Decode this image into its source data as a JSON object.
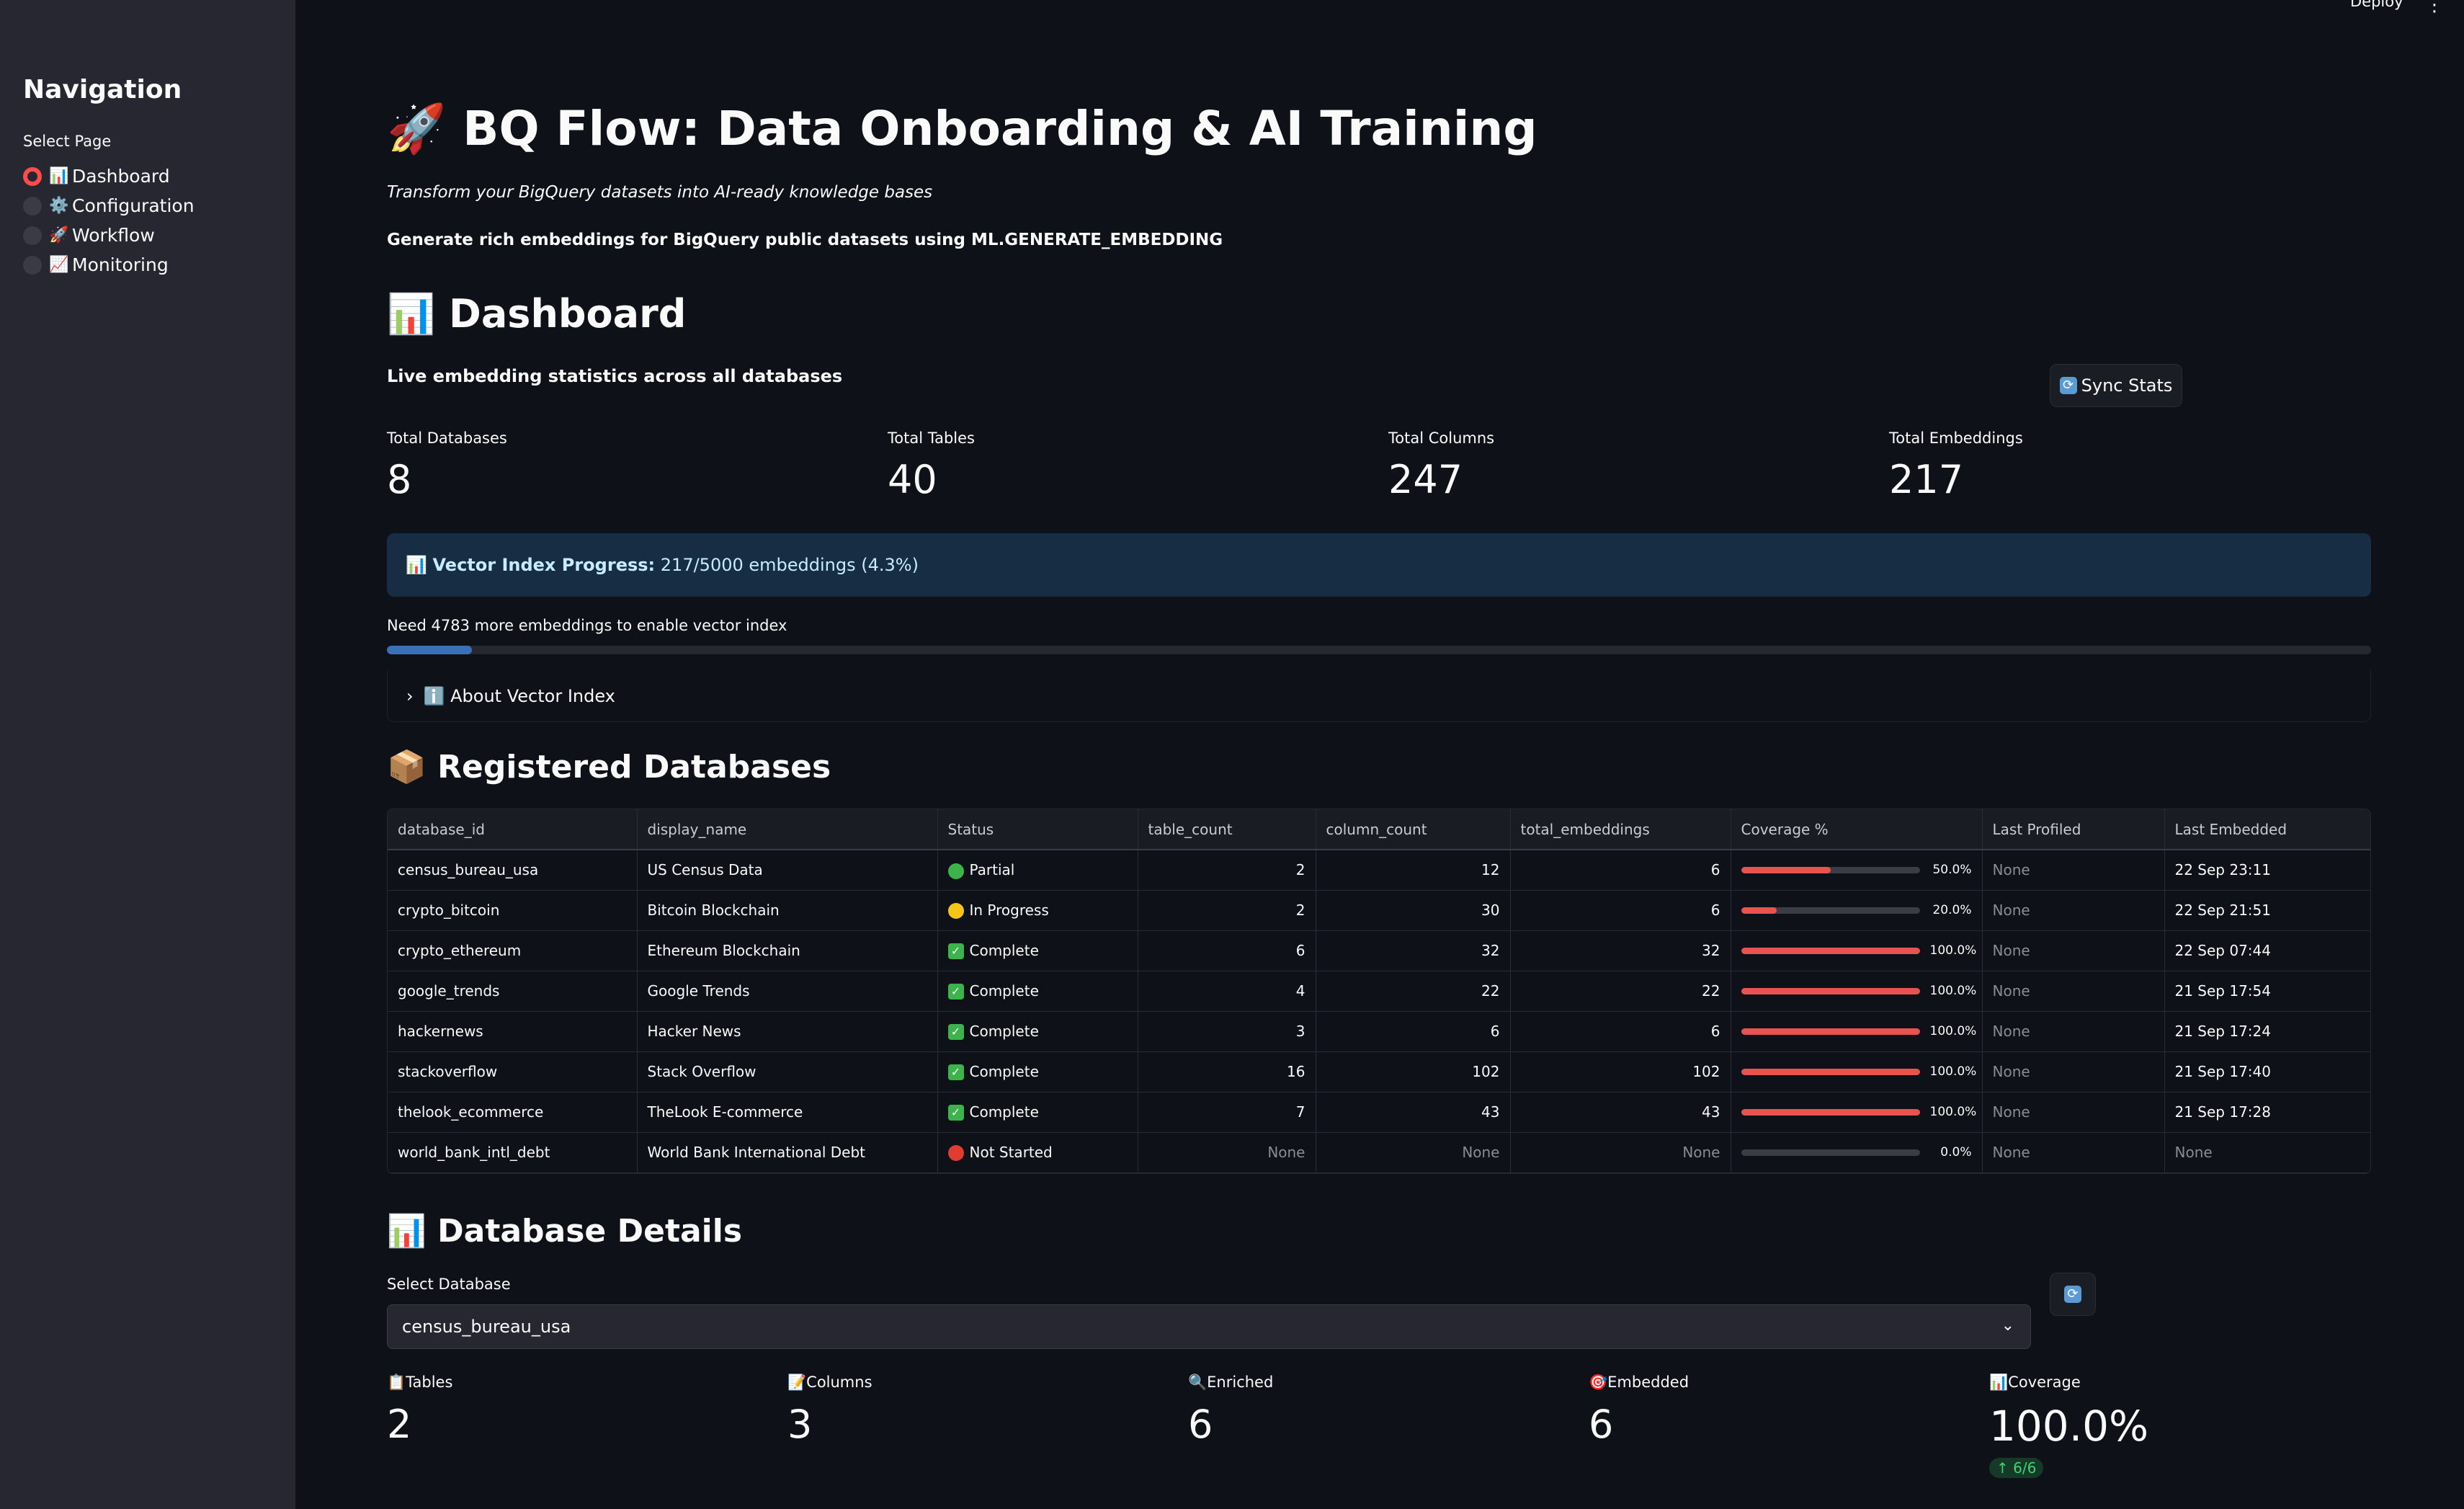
{
  "header": {
    "deploy_label": "Deploy",
    "menu_glyph": "⋮"
  },
  "sidebar": {
    "title": "Navigation",
    "select_label": "Select Page",
    "items": [
      {
        "emoji": "📊",
        "label": "Dashboard",
        "selected": true
      },
      {
        "emoji": "⚙️",
        "label": "Configuration",
        "selected": false
      },
      {
        "emoji": "🚀",
        "label": "Workflow",
        "selected": false
      },
      {
        "emoji": "📈",
        "label": "Monitoring",
        "selected": false
      }
    ]
  },
  "main": {
    "title": "🚀 BQ Flow: Data Onboarding & AI Training",
    "subtitle": "Transform your BigQuery datasets into AI-ready knowledge bases",
    "description": "Generate rich embeddings for BigQuery public datasets using ML.GENERATE_EMBEDDING",
    "dashboard_heading": "📊 Dashboard",
    "live_caption": "Live embedding statistics across all databases",
    "sync_label": "Sync Stats",
    "metrics": [
      {
        "label": "Total Databases",
        "value": "8"
      },
      {
        "label": "Total Tables",
        "value": "40"
      },
      {
        "label": "Total Columns",
        "value": "247"
      },
      {
        "label": "Total Embeddings",
        "value": "217"
      }
    ],
    "vector_info": {
      "prefix": "📊",
      "bold": "Vector Index Progress:",
      "text": "217/5000 embeddings (4.3%)"
    },
    "need_text": "Need 4783 more embeddings to enable vector index",
    "vector_progress": 0.043,
    "expander_label": "ℹ️ About Vector Index",
    "registered_heading": "📦 Registered Databases",
    "table": {
      "columns": [
        "database_id",
        "display_name",
        "Status",
        "table_count",
        "column_count",
        "total_embeddings",
        "Coverage %",
        "Last Profiled",
        "Last Embedded"
      ],
      "rows": [
        {
          "database_id": "census_bureau_usa",
          "display_name": "US Census Data",
          "status": "Partial",
          "status_color": "#3cb44b",
          "status_kind": "dot",
          "table_count": "2",
          "column_count": "12",
          "total_embeddings": "6",
          "coverage": 0.5,
          "coverage_text": "50.0%",
          "last_profiled": "None",
          "last_embedded": "22 Sep 23:11"
        },
        {
          "database_id": "crypto_bitcoin",
          "display_name": "Bitcoin Blockchain",
          "status": "In Progress",
          "status_color": "#f5c518",
          "status_kind": "dot",
          "table_count": "2",
          "column_count": "30",
          "total_embeddings": "6",
          "coverage": 0.2,
          "coverage_text": "20.0%",
          "last_profiled": "None",
          "last_embedded": "22 Sep 21:51"
        },
        {
          "database_id": "crypto_ethereum",
          "display_name": "Ethereum Blockchain",
          "status": "Complete",
          "status_color": "#3cb44b",
          "status_kind": "check",
          "table_count": "6",
          "column_count": "32",
          "total_embeddings": "32",
          "coverage": 1.0,
          "coverage_text": "100.0%",
          "last_profiled": "None",
          "last_embedded": "22 Sep 07:44"
        },
        {
          "database_id": "google_trends",
          "display_name": "Google Trends",
          "status": "Complete",
          "status_color": "#3cb44b",
          "status_kind": "check",
          "table_count": "4",
          "column_count": "22",
          "total_embeddings": "22",
          "coverage": 1.0,
          "coverage_text": "100.0%",
          "last_profiled": "None",
          "last_embedded": "21 Sep 17:54"
        },
        {
          "database_id": "hackernews",
          "display_name": "Hacker News",
          "status": "Complete",
          "status_color": "#3cb44b",
          "status_kind": "check",
          "table_count": "3",
          "column_count": "6",
          "total_embeddings": "6",
          "coverage": 1.0,
          "coverage_text": "100.0%",
          "last_profiled": "None",
          "last_embedded": "21 Sep 17:24"
        },
        {
          "database_id": "stackoverflow",
          "display_name": "Stack Overflow",
          "status": "Complete",
          "status_color": "#3cb44b",
          "status_kind": "check",
          "table_count": "16",
          "column_count": "102",
          "total_embeddings": "102",
          "coverage": 1.0,
          "coverage_text": "100.0%",
          "last_profiled": "None",
          "last_embedded": "21 Sep 17:40"
        },
        {
          "database_id": "thelook_ecommerce",
          "display_name": "TheLook E-commerce",
          "status": "Complete",
          "status_color": "#3cb44b",
          "status_kind": "check",
          "table_count": "7",
          "column_count": "43",
          "total_embeddings": "43",
          "coverage": 1.0,
          "coverage_text": "100.0%",
          "last_profiled": "None",
          "last_embedded": "21 Sep 17:28"
        },
        {
          "database_id": "world_bank_intl_debt",
          "display_name": "World Bank International Debt",
          "status": "Not Started",
          "status_color": "#e03c31",
          "status_kind": "dot",
          "table_count": "None",
          "column_count": "None",
          "total_embeddings": "None",
          "coverage": 0.0,
          "coverage_text": "0.0%",
          "last_profiled": "None",
          "last_embedded": "None"
        }
      ]
    },
    "details_heading": "📊 Database Details",
    "select_db_label": "Select Database",
    "select_db_value": "census_bureau_usa",
    "detail_metrics": [
      {
        "emoji": "📋",
        "label": "Tables",
        "value": "2"
      },
      {
        "emoji": "📝",
        "label": "Columns",
        "value": "3"
      },
      {
        "emoji": "🔍",
        "label": "Enriched",
        "value": "6"
      },
      {
        "emoji": "🎯",
        "label": "Embedded",
        "value": "6"
      },
      {
        "emoji": "📊",
        "label": "Coverage",
        "value": "100.0%",
        "delta": "↑ 6/6"
      }
    ]
  }
}
